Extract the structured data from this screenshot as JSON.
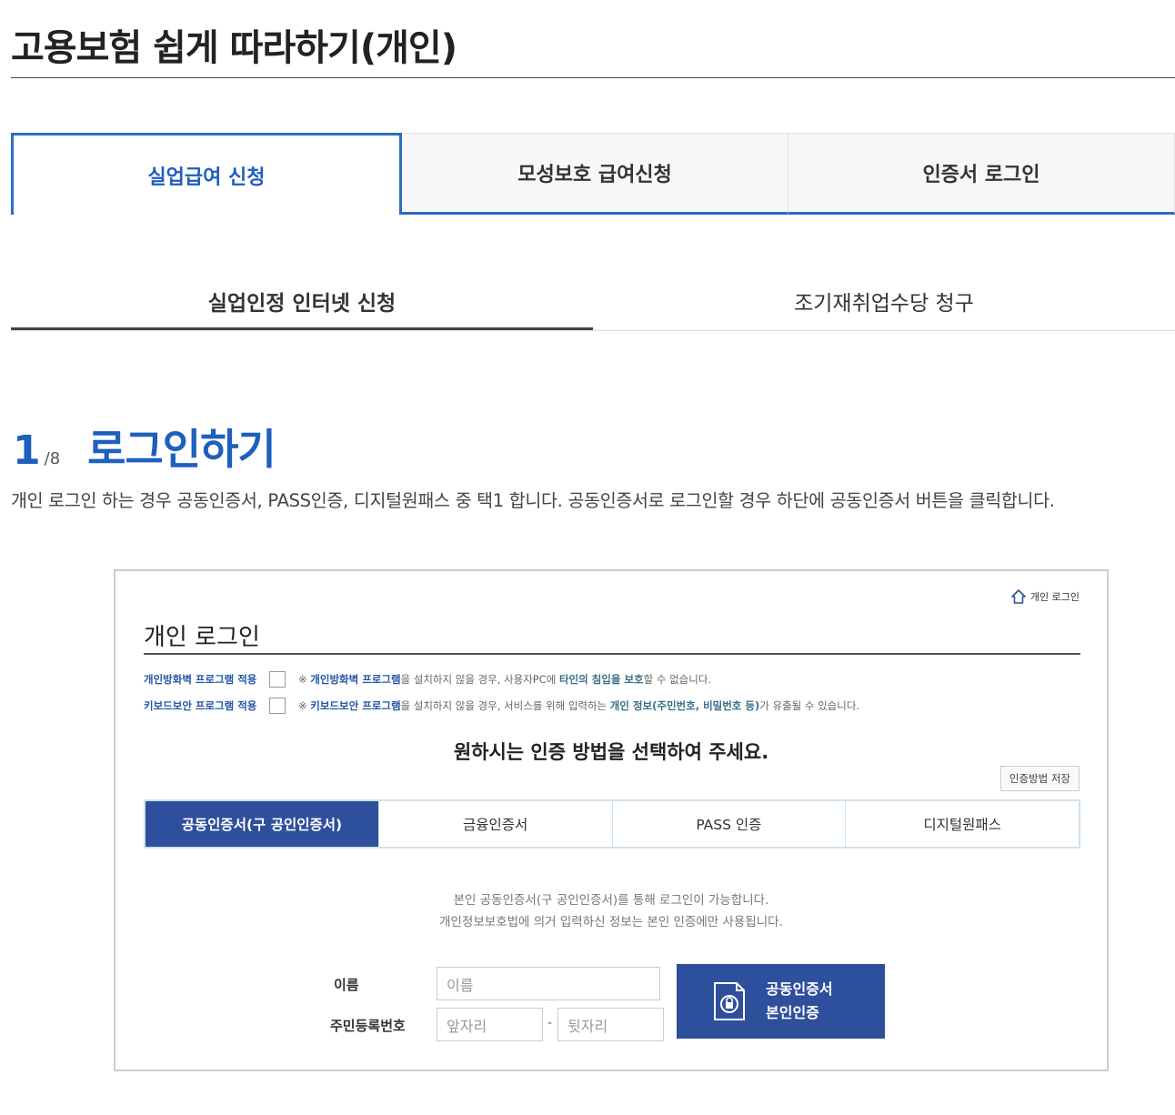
{
  "page": {
    "title": "고용보험 쉽게 따라하기(개인)"
  },
  "main_tabs": [
    {
      "label": "실업급여 신청",
      "active": true
    },
    {
      "label": "모성보호 급여신청",
      "active": false
    },
    {
      "label": "인증서 로그인",
      "active": false
    }
  ],
  "sub_tabs": [
    {
      "label": "실업인정 인터넷 신청",
      "active": true
    },
    {
      "label": "조기재취업수당 청구",
      "active": false
    }
  ],
  "step": {
    "current": "1",
    "total": "/8",
    "title": "로그인하기",
    "description": "개인 로그인 하는 경우 공동인증서, PASS인증, 디지털원패스 중 택1 합니다. 공동인증서로 로그인할 경우 하단에 공동인증서 버튼을 클릭합니다."
  },
  "screenshot": {
    "home_link": "개인 로그인",
    "title": "개인 로그인",
    "firewall": {
      "label": "개인방화벽 프로그램 적용",
      "note_prefix": "※ ",
      "note_b1": "개인방화벽 프로그램",
      "note_mid": "을 설치하지 않을 경우, 사용자PC에 ",
      "note_b2": "타인의 침입을 보호",
      "note_end": "할 수 없습니다."
    },
    "keyboard": {
      "label": "키보드보안 프로그램 적용",
      "note_prefix": "※ ",
      "note_b1": "키보드보안 프로그램",
      "note_mid": "을 설치하지 않을 경우, 서비스를 위해 입력하는 ",
      "note_b2": "개인 정보(주민번호, 비밀번호 등)",
      "note_end": "가 유출될 수 있습니다."
    },
    "choose_text": "원하시는 인증 방법을 선택하여 주세요.",
    "save_button": "인증방법 저장",
    "auth_tabs": [
      {
        "label": "공동인증서(구 공인인증서)",
        "active": true
      },
      {
        "label": "금융인증서",
        "active": false
      },
      {
        "label": "PASS 인증",
        "active": false
      },
      {
        "label": "디지털원패스",
        "active": false
      }
    ],
    "info_line1": "본인 공동인증서(구 공인인증서)를 통해 로그인이 가능합니다.",
    "info_line2": "개인정보보호법에 의거 입력하신 정보는 본인 인증에만 사용됩니다.",
    "form": {
      "name_label": "이름",
      "name_placeholder": "이름",
      "rrn_label": "주민등록번호",
      "rrn_front_placeholder": "앞자리",
      "rrn_dash": "-",
      "rrn_back_placeholder": "뒷자리"
    },
    "cert_button": {
      "line1": "공동인증서",
      "line2": "본인인증"
    }
  },
  "colors": {
    "accent_blue": "#1f5fbd",
    "tab_border": "#2c6bc4",
    "auth_active": "#2e4f9c"
  }
}
